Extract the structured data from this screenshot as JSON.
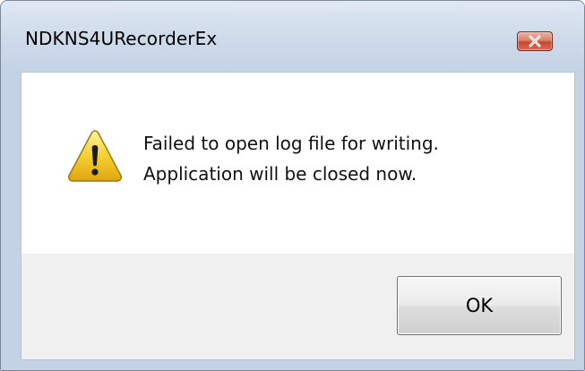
{
  "window": {
    "title": "NDKNS4URecorderEx",
    "close_icon": "close-icon"
  },
  "message": {
    "icon": "warning-icon",
    "lines": [
      "Failed to open log file for writing.",
      "Application will be closed now."
    ]
  },
  "buttons": {
    "ok_label": "OK"
  },
  "colors": {
    "close_button": "#c8462e",
    "warning_yellow": "#f2c21a",
    "frame": "#c3d2e5"
  }
}
